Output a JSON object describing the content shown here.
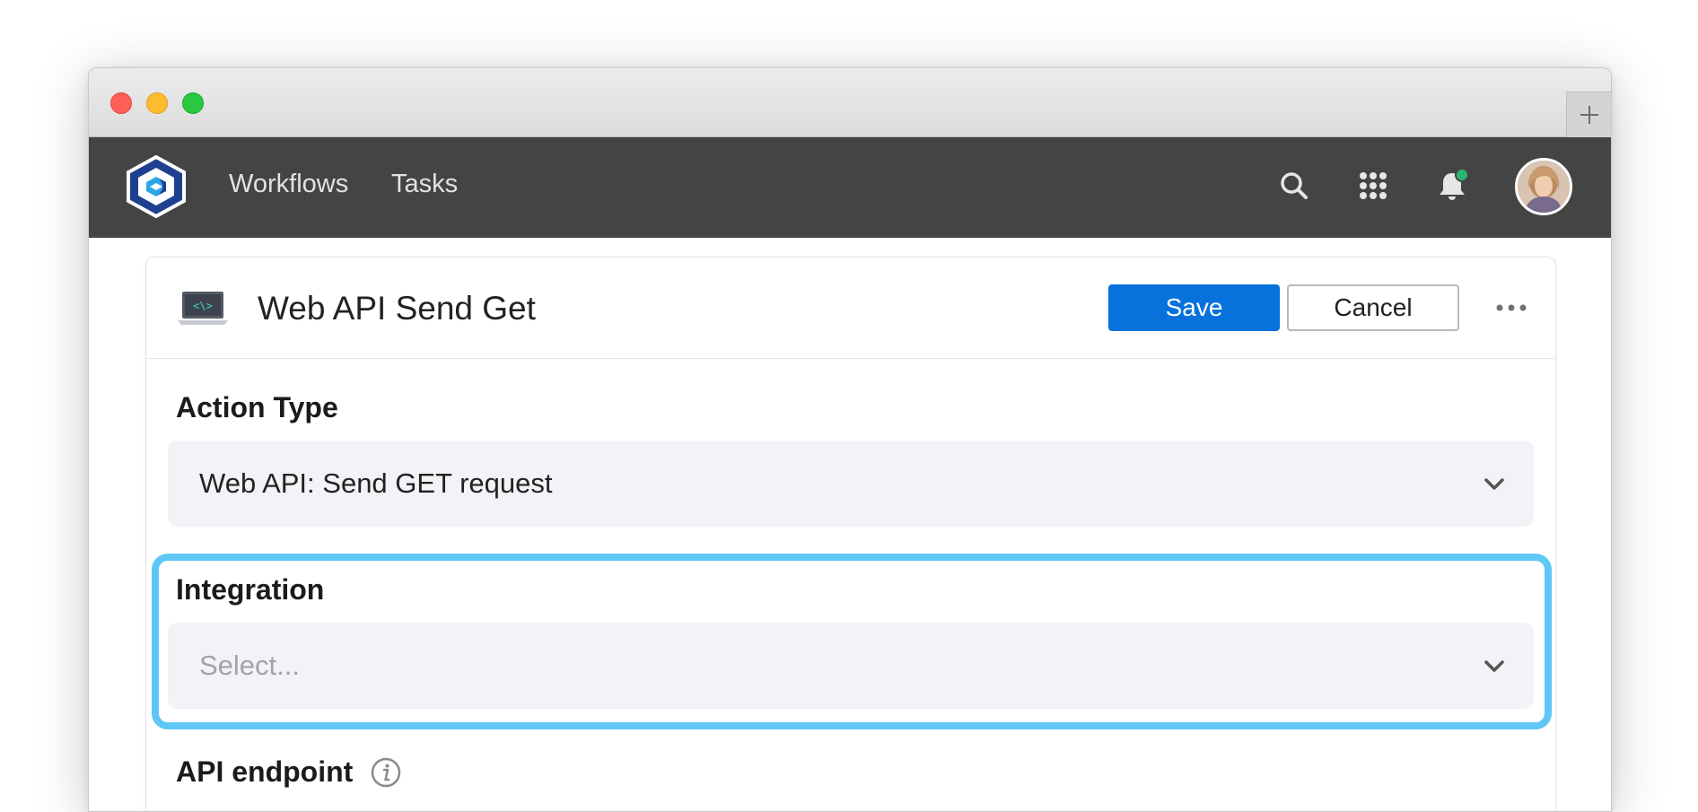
{
  "nav": {
    "links": [
      {
        "label": "Workflows"
      },
      {
        "label": "Tasks"
      }
    ],
    "icons": [
      "search-icon",
      "apps-grid-icon",
      "bell-icon"
    ],
    "notification_dot_color": "#2bb673"
  },
  "header": {
    "title": "Web API Send Get",
    "save_label": "Save",
    "cancel_label": "Cancel"
  },
  "form": {
    "action_type": {
      "label": "Action Type",
      "value": "Web API: Send GET request"
    },
    "integration": {
      "label": "Integration",
      "placeholder": "Select..."
    },
    "api_endpoint": {
      "label": "API endpoint"
    }
  },
  "colors": {
    "navbar": "#444444",
    "primary": "#0771dc",
    "highlight": "#5ec7f6",
    "field_bg": "#f2f3f6"
  }
}
